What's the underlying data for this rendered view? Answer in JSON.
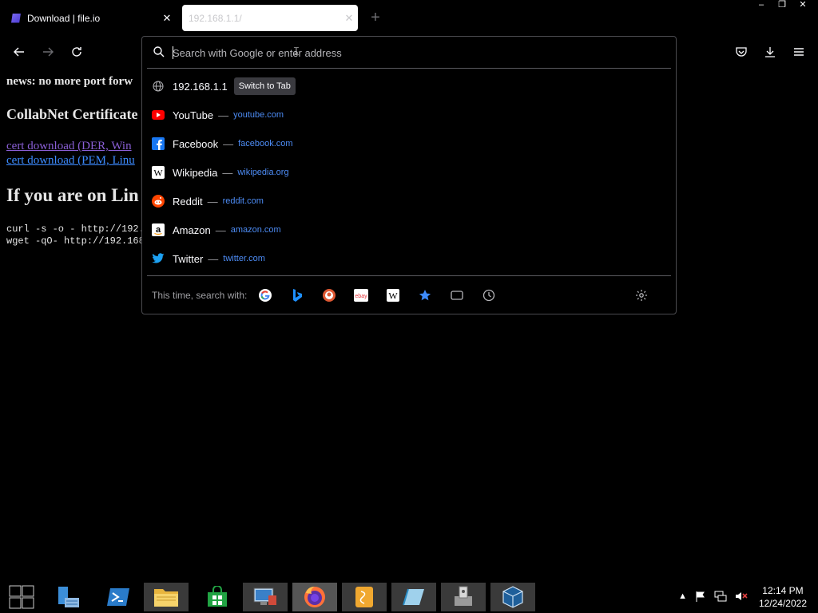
{
  "tabs": [
    {
      "title": "Download | file.io",
      "active": false
    },
    {
      "title": "192.168.1.1/",
      "active": true
    }
  ],
  "window_controls": {
    "minimize": "–",
    "restore": "❐",
    "close": "✕"
  },
  "page": {
    "news": "news: no more port forw",
    "heading1": "CollabNet Certificate",
    "link1": "cert download (DER, Win",
    "link2": "cert download (PEM, Linu",
    "heading2": "If you are on Lin",
    "code1": "curl -s -o - http://192.",
    "code2": "wget -qO- http://192.168"
  },
  "urlbar": {
    "placeholder": "Search with Google or enter address",
    "results": [
      {
        "icon": "globe-icon",
        "name": "192.168.1.1",
        "action": "Switch to Tab"
      },
      {
        "icon": "youtube-icon",
        "name": "YouTube",
        "url": "youtube.com"
      },
      {
        "icon": "facebook-icon",
        "name": "Facebook",
        "url": "facebook.com"
      },
      {
        "icon": "wikipedia-icon",
        "name": "Wikipedia",
        "url": "wikipedia.org"
      },
      {
        "icon": "reddit-icon",
        "name": "Reddit",
        "url": "reddit.com"
      },
      {
        "icon": "amazon-icon",
        "name": "Amazon",
        "url": "amazon.com"
      },
      {
        "icon": "twitter-icon",
        "name": "Twitter",
        "url": "twitter.com"
      }
    ],
    "separator": "—",
    "engines_label": "This time, search with:",
    "engines": [
      "google-icon",
      "bing-icon",
      "duckduckgo-icon",
      "ebay-icon",
      "wikipedia-icon",
      "bookmarks-icon",
      "tabs-icon",
      "history-icon"
    ]
  },
  "taskbar": {
    "clock_time": "12:14 PM",
    "clock_date": "12/24/2022"
  },
  "colors": {
    "link_visited": "#8a5fd6",
    "link": "#3d8bff",
    "suggestion_url": "#4d8cf5"
  }
}
